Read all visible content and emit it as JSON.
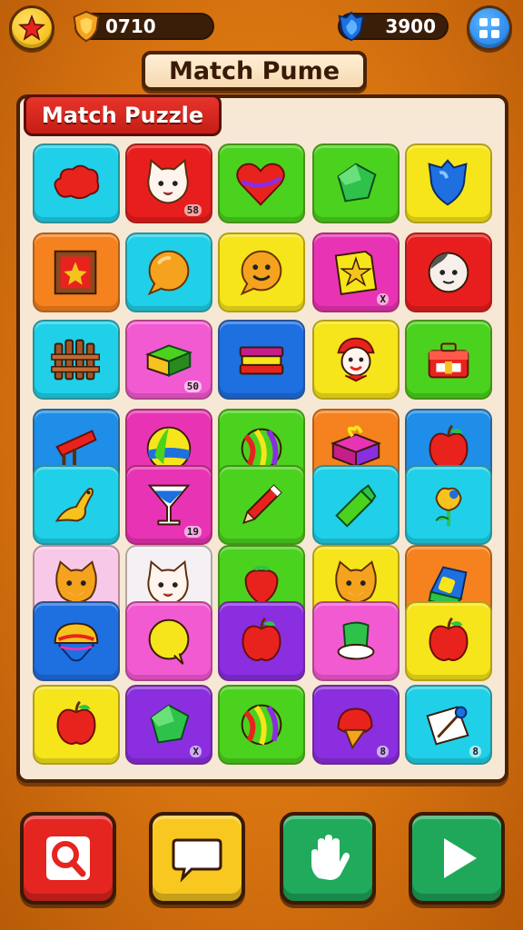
{
  "header": {
    "coins_value": "0710",
    "gems_value": "3900",
    "star_icon": "star-icon",
    "shield_icon": "shield-coin-icon",
    "gem_icon": "blue-gem-icon",
    "menu_icon": "grid-menu-icon"
  },
  "titles": {
    "main_banner": "Match Pume",
    "sub_banner": "Match Puzzle"
  },
  "tiles": [
    {
      "icon": "red-cloud-icon",
      "color": "#1fd0e8",
      "badge": ""
    },
    {
      "icon": "cat-face-icon",
      "color": "#e81e1e",
      "badge": "58"
    },
    {
      "icon": "heart-icon",
      "color": "#4ad21e",
      "badge": ""
    },
    {
      "icon": "green-gem-icon",
      "color": "#4ad21e",
      "badge": ""
    },
    {
      "icon": "blue-shield-icon",
      "color": "#f5e51a",
      "badge": ""
    },
    {
      "icon": "picture-frame-icon",
      "color": "#f5821e",
      "badge": ""
    },
    {
      "icon": "orange-speech-bubble-icon",
      "color": "#1fd0e8",
      "badge": ""
    },
    {
      "icon": "smiley-bubble-icon",
      "color": "#f5e51a",
      "badge": ""
    },
    {
      "icon": "star-note-icon",
      "color": "#e834b4",
      "badge": "X"
    },
    {
      "icon": "bald-head-icon",
      "color": "#e81e1e",
      "badge": ""
    },
    {
      "icon": "wooden-fence-icon",
      "color": "#1fd0e8",
      "badge": ""
    },
    {
      "icon": "cake-block-icon",
      "color": "#f25ad2",
      "badge": "50"
    },
    {
      "icon": "book-stack-icon",
      "color": "#1e6fe0",
      "badge": ""
    },
    {
      "icon": "clown-icon",
      "color": "#f5e51a",
      "badge": ""
    },
    {
      "icon": "first-aid-box-icon",
      "color": "#4ad21e",
      "badge": ""
    },
    {
      "icon": "paintbrush-icon",
      "color": "#1e8ee8",
      "badge": ""
    },
    {
      "icon": "beach-ball-icon",
      "color": "#e834b4",
      "badge": ""
    },
    {
      "icon": "striped-ball-icon",
      "color": "#4ad21e",
      "badge": ""
    },
    {
      "icon": "gift-box-icon",
      "color": "#f5821e",
      "badge": ""
    },
    {
      "icon": "apple-icon",
      "color": "#1e8ee8",
      "badge": ""
    },
    {
      "icon": "fish-icon",
      "color": "#1fd0e8",
      "badge": ""
    },
    {
      "icon": "cocktail-glass-icon",
      "color": "#e834b4",
      "badge": "19"
    },
    {
      "icon": "pencil-icon",
      "color": "#4ad21e",
      "badge": ""
    },
    {
      "icon": "crayon-icon",
      "color": "#1fd0e8",
      "badge": ""
    },
    {
      "icon": "yellow-flower-icon",
      "color": "#1fd0e8",
      "badge": ""
    },
    {
      "icon": "fox-face-icon",
      "color": "#f7c8e8",
      "badge": ""
    },
    {
      "icon": "cat-face-icon",
      "color": "#f4f0f4",
      "badge": ""
    },
    {
      "icon": "strawberry-icon",
      "color": "#4ad21e",
      "badge": ""
    },
    {
      "icon": "fox-face-icon",
      "color": "#f5e51a",
      "badge": ""
    },
    {
      "icon": "blue-gem-box-icon",
      "color": "#f5821e",
      "badge": ""
    },
    {
      "icon": "rainbow-shell-icon",
      "color": "#1e6fe0",
      "badge": ""
    },
    {
      "icon": "yellow-speech-bubble-icon",
      "color": "#f25ad2",
      "badge": ""
    },
    {
      "icon": "red-apple-icon",
      "color": "#8a2ee0",
      "badge": ""
    },
    {
      "icon": "green-cup-icon",
      "color": "#f25ad2",
      "badge": ""
    },
    {
      "icon": "apple-icon",
      "color": "#f5e51a",
      "badge": ""
    },
    {
      "icon": "apple-icon",
      "color": "#f5e51a",
      "badge": ""
    },
    {
      "icon": "green-gem-icon",
      "color": "#8a2ee0",
      "badge": "X"
    },
    {
      "icon": "striped-ball-icon",
      "color": "#4ad21e",
      "badge": ""
    },
    {
      "icon": "ice-cream-icon",
      "color": "#8a2ee0",
      "badge": "8"
    },
    {
      "icon": "paper-pin-icon",
      "color": "#1fd0e8",
      "badge": "8"
    }
  ],
  "bottom_buttons": [
    {
      "icon": "magnifier-icon",
      "color": "#e52520"
    },
    {
      "icon": "chat-bubble-icon",
      "color": "#f8c820"
    },
    {
      "icon": "hand-icon",
      "color": "#1faa5c"
    },
    {
      "icon": "play-icon",
      "color": "#1fa85a"
    }
  ]
}
